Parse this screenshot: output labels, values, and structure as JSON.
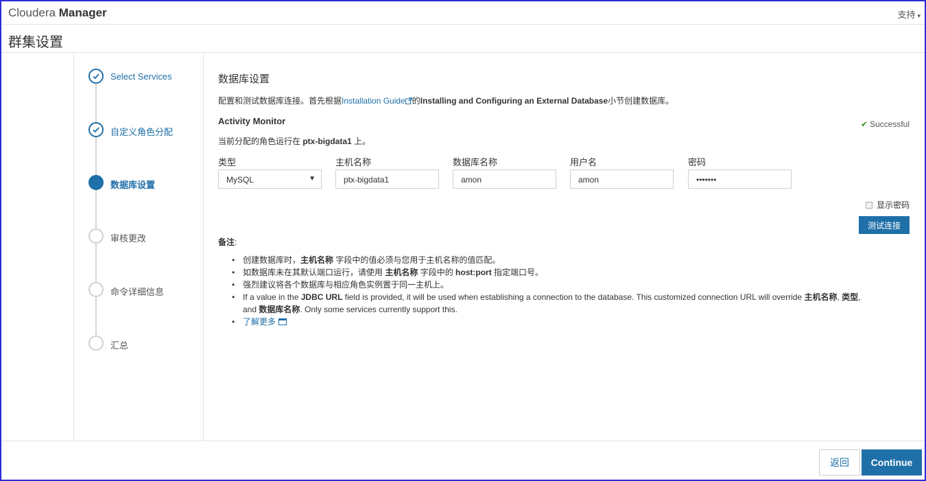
{
  "header": {
    "brand_light": "Cloudera",
    "brand_bold": "Manager",
    "support_label": "支持"
  },
  "page": {
    "title": "群集设置"
  },
  "wizard": {
    "steps": [
      {
        "label": "Select Services",
        "state": "done"
      },
      {
        "label": "自定义角色分配",
        "state": "done"
      },
      {
        "label": "数据库设置",
        "state": "active"
      },
      {
        "label": "审核更改",
        "state": "pending"
      },
      {
        "label": "命令详细信息",
        "state": "pending"
      },
      {
        "label": "汇总",
        "state": "pending"
      }
    ]
  },
  "main": {
    "section_title": "数据库设置",
    "intro_prefix": "配置和测试数据库连接。首先根据",
    "intro_link": "Installation Guide",
    "intro_mid": "的",
    "intro_bold": "Installing and Configuring an External Database",
    "intro_suffix": "小节创建数据库。",
    "monitor_title": "Activity Monitor",
    "status_text": "Successful",
    "host_prefix": "当前分配的角色运行在 ",
    "host_name": "ptx-bigdata1",
    "host_suffix": " 上。",
    "fields": {
      "type_label": "类型",
      "type_value": "MySQL",
      "host_label": "主机名称",
      "host_value": "ptx-bigdata1",
      "db_label": "数据库名称",
      "db_value": "amon",
      "user_label": "用户名",
      "user_value": "amon",
      "pwd_label": "密码",
      "pwd_value": "•••••••"
    },
    "show_password_label": "显示密码",
    "test_button": "测试连接",
    "notes_title": "备注",
    "notes_colon": ":",
    "notes": {
      "n1_a": "创建数据库时，",
      "n1_b": "主机名称",
      "n1_c": " 字段中的值必须与您用于主机名称的值匹配。",
      "n2_a": "如数据库未在其默认端口运行，请使用 ",
      "n2_b": "主机名称",
      "n2_c": " 字段中的 ",
      "n2_d": "host:port",
      "n2_e": " 指定端口号。",
      "n3": "强烈建议将各个数据库与相应角色实例置于同一主机上。",
      "n4_a": "If a value in the ",
      "n4_b": "JDBC URL",
      "n4_c": " field is provided, it will be used when establishing a connection to the database. This customized connection URL will override ",
      "n4_d": "主机名称",
      "n4_e": ", ",
      "n4_f": "类型",
      "n4_g": ",",
      "n4_h": "and ",
      "n4_i": "数据库名称",
      "n4_j": ". Only some services currently support this.",
      "learn_more": "了解更多"
    }
  },
  "footer": {
    "back_label": "返回",
    "continue_label": "Continue"
  }
}
